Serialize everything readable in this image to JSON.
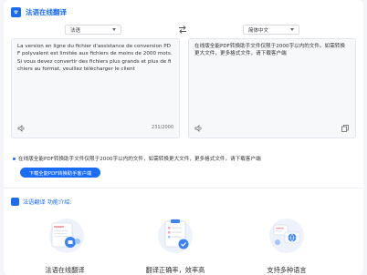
{
  "header": {
    "title": "法语在线翻译"
  },
  "source_lang": "法语",
  "target_lang": "简体中文",
  "source_text": "La version en ligne du fichier d'assistance de conversion PDF polyvalent est limitée aux fichiers de moins de 2000 mots. Si vous devez convertir des fichiers plus grands et plus de fichiers au format, veuillez télécharger le client",
  "char_count": "231/2000",
  "target_text": "在线版全能PDF转换助手文件仅限于2000字以内的文件。如需转换更大文件，更多格式文件，请下载客户端",
  "notice": "在线版全能PDF转换助手文件仅限于2000字以内的文件，如需转换更大文件，更多格式文件，请下载客户端",
  "download_button": "下载全能PDF转换助手客户端",
  "features_title": "法语翻译 功能介绍:",
  "features": [
    {
      "label": "法语在线翻译",
      "icon": "french-document-icon"
    },
    {
      "label": "翻译正确率，效率高",
      "icon": "accuracy-clipboard-icon"
    },
    {
      "label": "支持多种语言",
      "icon": "multi-language-icon"
    }
  ],
  "colors": {
    "accent": "#1a6cf5",
    "panel": "#ffffff",
    "background": "#f3f5f8"
  }
}
